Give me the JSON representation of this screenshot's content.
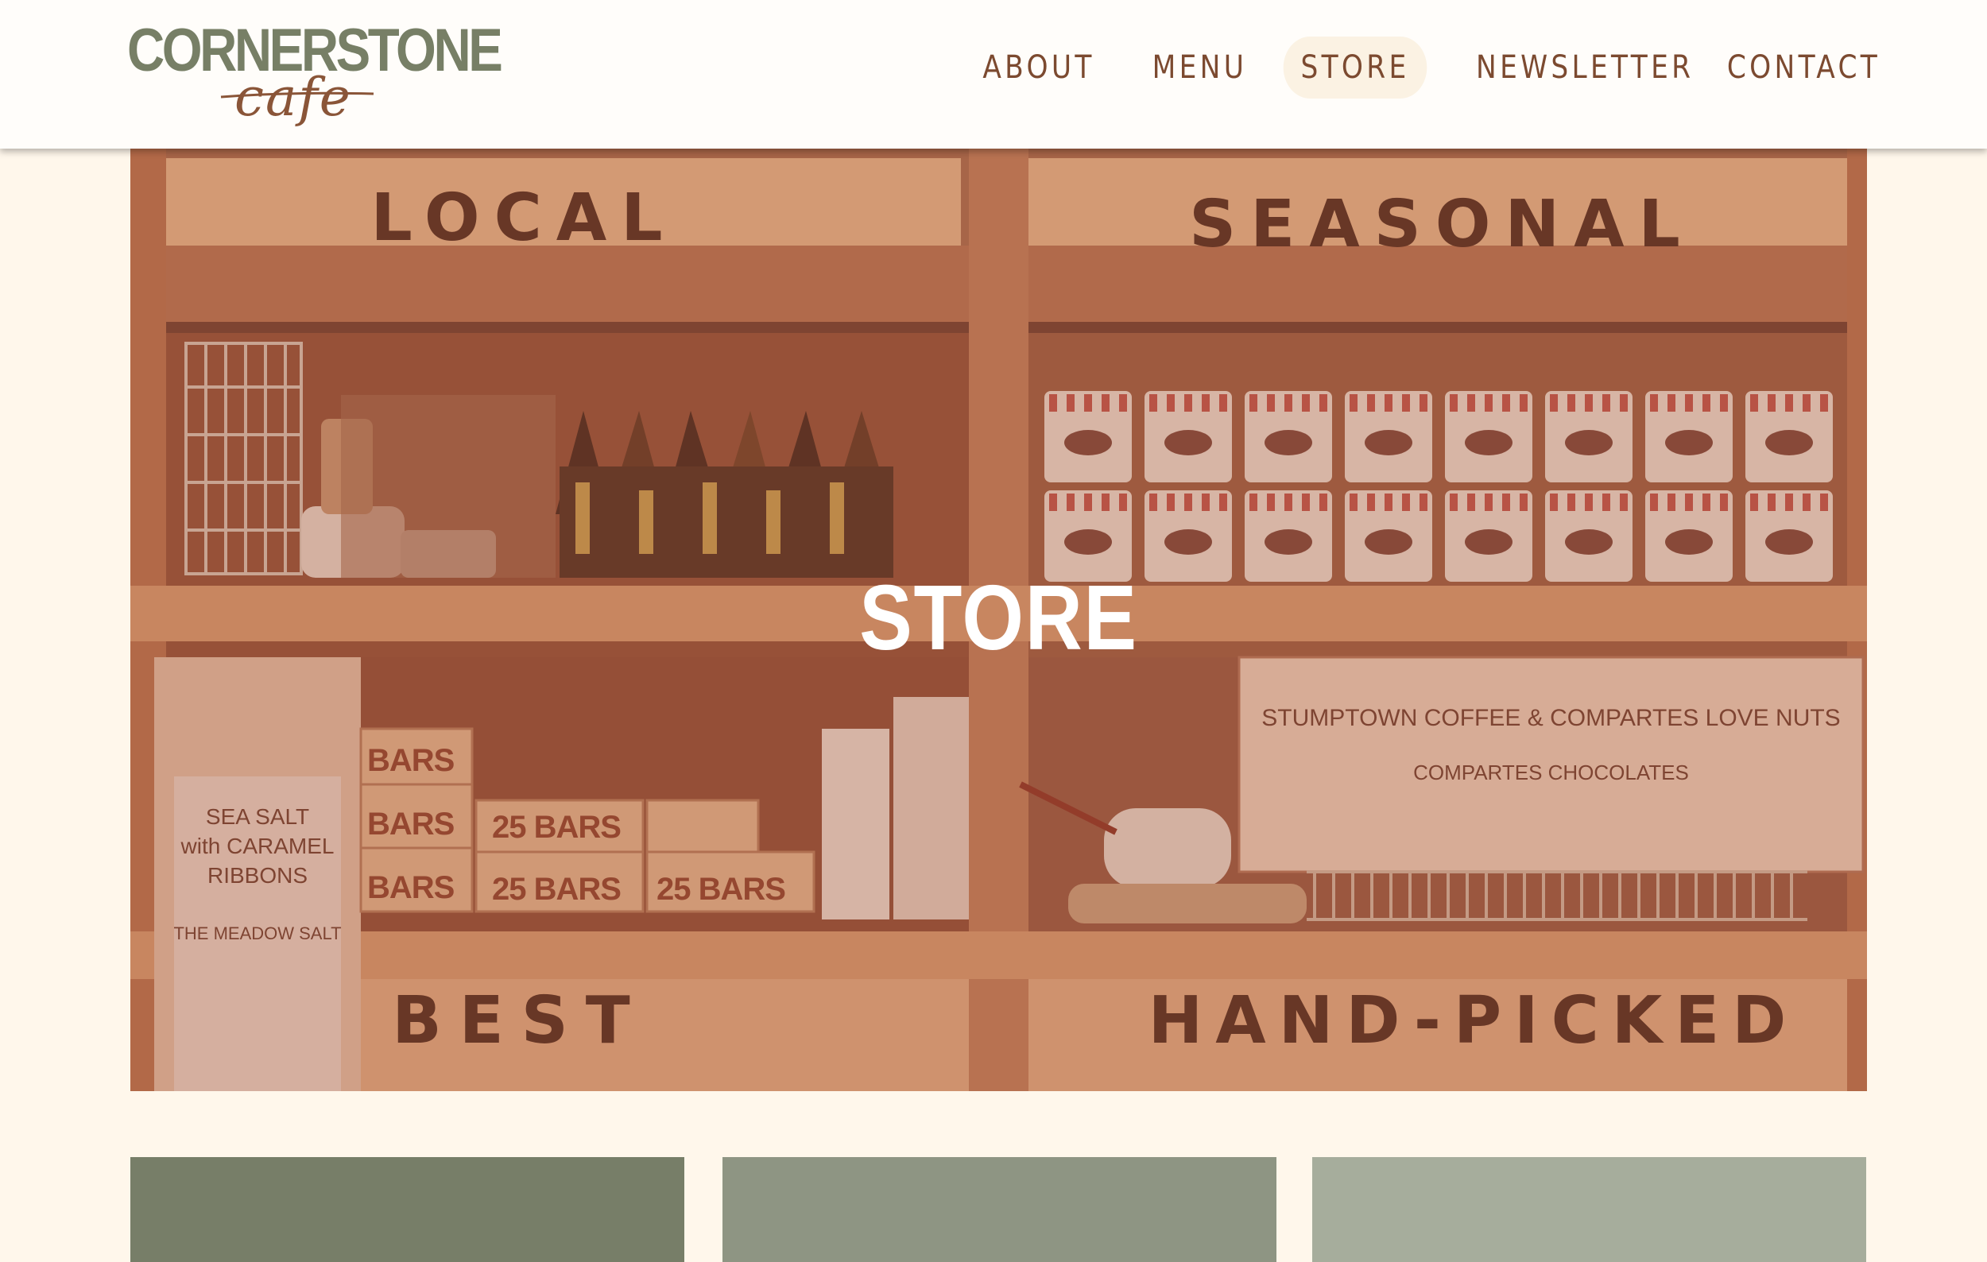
{
  "brand": {
    "name_main": "CORNERSTONE",
    "name_sub": "cafe"
  },
  "nav": {
    "items": [
      {
        "label": "ABOUT",
        "active": false
      },
      {
        "label": "MENU",
        "active": false
      },
      {
        "label": "STORE",
        "active": true
      },
      {
        "label": "NEWSLETTER",
        "active": false
      },
      {
        "label": "CONTACT",
        "active": false
      }
    ]
  },
  "hero": {
    "title": "STORE",
    "signs": {
      "top_left": "LOCAL",
      "top_right": "SEASONAL",
      "bottom_left": "BEST",
      "bottom_right": "HAND-PICKED"
    },
    "box_labels": [
      "BARS",
      "25 BARS",
      "BARS",
      "25 BARS",
      "BARS",
      "25 BARS",
      "25 BARS"
    ],
    "left_card": {
      "line1": "SEA SALT",
      "line2": "with CARAMEL",
      "line3": "RIBBONS",
      "line4": "THE MEADOW SALT"
    },
    "right_card": {
      "line1": "STUMPTOWN COFFEE & COMPARTES LOVE NUTS",
      "line2": "COMPARTES CHOCOLATES"
    }
  },
  "colors": {
    "background": "#fff7eb",
    "header_bg": "#fffdfa",
    "nav_text": "#7c4a30",
    "nav_active_bg": "#fbf2e3",
    "logo_green": "#777f66",
    "logo_brown": "#8a5538",
    "tile_1": "#777e68",
    "tile_2": "#8e9583",
    "tile_3": "#a6ad9c"
  }
}
